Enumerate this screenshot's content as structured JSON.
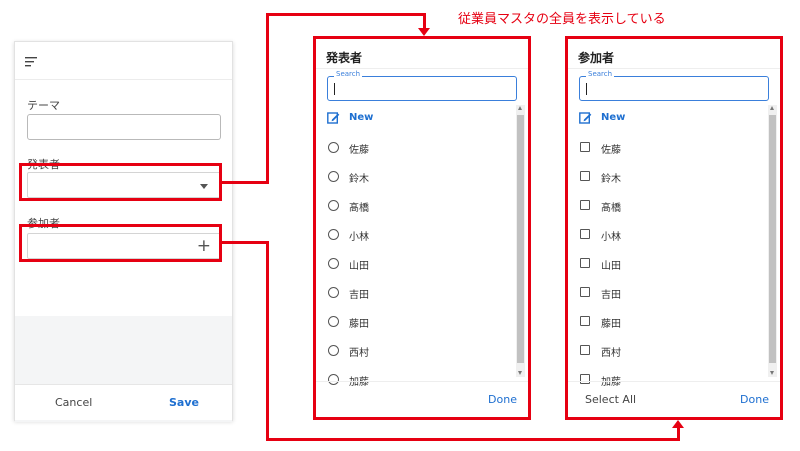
{
  "annotation": "従業員マスタの全員を表示している",
  "form": {
    "fields": {
      "theme_label": "テーマ",
      "presenter_label": "発表者",
      "participants_label": "参加者"
    },
    "footer": {
      "cancel": "Cancel",
      "save": "Save"
    }
  },
  "presenter_dialog": {
    "title": "発表者",
    "search_placeholder": "Search",
    "new_label": "New",
    "items": [
      "佐藤",
      "鈴木",
      "髙橋",
      "小林",
      "山田",
      "吉田",
      "藤田",
      "西村",
      "加藤"
    ],
    "done": "Done"
  },
  "participant_dialog": {
    "title": "参加者",
    "search_placeholder": "Search",
    "new_label": "New",
    "items": [
      "佐藤",
      "鈴木",
      "髙橋",
      "小林",
      "山田",
      "吉田",
      "藤田",
      "西村",
      "加藤"
    ],
    "select_all": "Select All",
    "done": "Done"
  },
  "colors": {
    "highlight": "#e60012",
    "accent": "#1e6fd0"
  }
}
